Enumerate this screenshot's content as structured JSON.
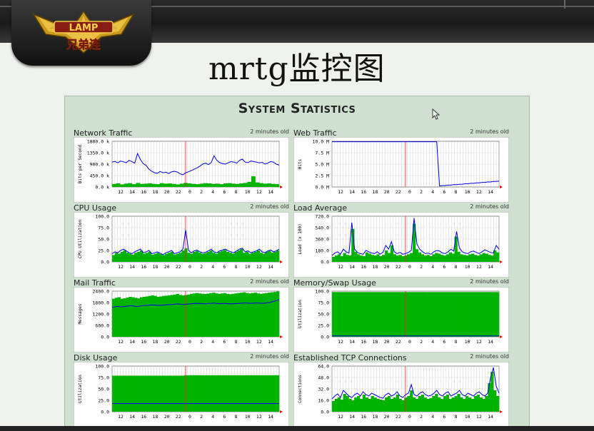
{
  "slide": {
    "title": "mrtg监控图"
  },
  "logo": {
    "text_latin": "LAMP",
    "text_cn": "兄弟连"
  },
  "stats": {
    "title": "System Statistics",
    "panels": [
      {
        "title": "Network Traffic",
        "age": "2 minutes old",
        "ylabel": "Bits per Second",
        "yticks": [
          "1800.0 k",
          "1350.0 k",
          "900.0 k",
          "450.0 k",
          "0.0 k"
        ],
        "ymax": 1800,
        "green": [
          120,
          140,
          100,
          130,
          150,
          110,
          160,
          120,
          130,
          140,
          120,
          110,
          150,
          130,
          140,
          120,
          100,
          130,
          160,
          140,
          120,
          110,
          130,
          150,
          140,
          120,
          130,
          110,
          140,
          150,
          130,
          120,
          140,
          160,
          200,
          420,
          180,
          150,
          130,
          140,
          120,
          110
        ],
        "blue": [
          980,
          1010,
          950,
          1020,
          990,
          960,
          1050,
          1000,
          940,
          1320,
          1080,
          920,
          850,
          700,
          620,
          560,
          540,
          610,
          560,
          580,
          530,
          600,
          620,
          590,
          520,
          480,
          560,
          600,
          650,
          700,
          750,
          820,
          900,
          940,
          880,
          960,
          1230,
          1050,
          960,
          920,
          900,
          950,
          1000,
          980,
          940,
          1050,
          1100,
          980,
          960,
          1020,
          1000,
          980,
          950,
          970,
          900,
          940,
          1000,
          980,
          900,
          860
        ]
      },
      {
        "title": "Web Traffic",
        "age": "2 minutes old",
        "ylabel": "Hits",
        "yticks": [
          "10.0 M",
          "7.5 M",
          "5.0 M",
          "2.5 M",
          "0.0 M"
        ],
        "ymax": 10,
        "green": [],
        "blue": [
          9.9,
          9.9,
          9.9,
          9.9,
          9.9,
          9.9,
          9.9,
          9.9,
          9.9,
          9.9,
          9.9,
          9.9,
          9.9,
          9.9,
          9.9,
          9.9,
          9.9,
          9.9,
          9.9,
          9.9,
          9.9,
          9.9,
          9.9,
          9.9,
          9.9,
          9.9,
          9.9,
          9.9,
          9.9,
          9.9,
          9.9,
          9.9,
          9.9,
          9.9,
          9.9,
          9.9,
          9.9,
          9.9,
          0.2,
          0.3,
          0.3,
          0.4,
          0.4,
          0.5,
          0.5,
          0.6,
          0.6,
          0.7,
          0.7,
          0.8,
          0.8,
          0.9,
          0.9,
          1.0,
          1.0,
          1.1,
          1.1,
          1.2,
          1.2,
          1.3
        ]
      },
      {
        "title": "CPU Usage",
        "age": "2 minutes old",
        "ylabel": "CPU Utilization",
        "yticks": [
          "100.0",
          "75.0",
          "50.0",
          "25.0",
          "0.0"
        ],
        "ymax": 100,
        "green": [
          15,
          20,
          18,
          22,
          25,
          20,
          18,
          16,
          20,
          22,
          25,
          18,
          20,
          22,
          16,
          18,
          20,
          17,
          15,
          18,
          20,
          22,
          16,
          18,
          20,
          25,
          30,
          20,
          18,
          22,
          24,
          20,
          18,
          19,
          22,
          25,
          20,
          18,
          22,
          24,
          26,
          22,
          20,
          18,
          22,
          25,
          28,
          20,
          22,
          18,
          20,
          22,
          25,
          20,
          18,
          22,
          24,
          20,
          22,
          25
        ],
        "blue": [
          18,
          22,
          20,
          25,
          28,
          24,
          20,
          18,
          22,
          25,
          28,
          20,
          22,
          25,
          18,
          20,
          22,
          19,
          16,
          20,
          22,
          25,
          18,
          20,
          22,
          28,
          70,
          25,
          20,
          24,
          26,
          22,
          20,
          21,
          24,
          28,
          22,
          20,
          24,
          26,
          28,
          24,
          22,
          20,
          24,
          28,
          30,
          22,
          24,
          20,
          22,
          24,
          28,
          22,
          20,
          24,
          26,
          22,
          24,
          28
        ]
      },
      {
        "title": "Load Average",
        "age": "2 minutes old",
        "ylabel": "Load (x 100)",
        "yticks": [
          "720.0",
          "540.0",
          "360.0",
          "180.0",
          "0.0"
        ],
        "ymax": 720,
        "green": [
          80,
          100,
          120,
          90,
          140,
          110,
          100,
          520,
          160,
          120,
          100,
          90,
          150,
          130,
          110,
          100,
          120,
          90,
          110,
          180,
          140,
          260,
          120,
          100,
          110,
          90,
          100,
          120,
          140,
          600,
          200,
          150,
          120,
          100,
          110,
          90,
          120,
          140,
          130,
          110,
          100,
          120,
          150,
          130,
          400,
          160,
          120,
          110,
          100,
          120,
          130,
          110,
          100,
          120,
          140,
          130,
          110,
          100,
          180,
          150
        ],
        "blue": [
          100,
          140,
          160,
          120,
          200,
          160,
          140,
          620,
          200,
          150,
          130,
          120,
          180,
          160,
          140,
          130,
          160,
          120,
          150,
          260,
          200,
          320,
          160,
          130,
          150,
          120,
          130,
          150,
          180,
          690,
          280,
          200,
          160,
          130,
          140,
          120,
          160,
          180,
          170,
          140,
          130,
          160,
          200,
          170,
          480,
          220,
          160,
          140,
          130,
          160,
          170,
          150,
          130,
          160,
          190,
          170,
          150,
          140,
          260,
          200
        ]
      },
      {
        "title": "Mail Traffic",
        "age": "2 minutes old",
        "ylabel": "Messages",
        "yticks": [
          "2400.0",
          "1800.0",
          "1200.0",
          "600.0",
          "0.0"
        ],
        "ymax": 2400,
        "green": [
          2000,
          2050,
          2080,
          2000,
          2020,
          2060,
          2100,
          2080,
          2050,
          2020,
          2080,
          2100,
          2120,
          2150,
          2180,
          2150,
          2100,
          2120,
          2150,
          2160,
          2180,
          2200,
          2220,
          2250,
          2200,
          2180,
          2200,
          2220,
          2260,
          2280,
          2300,
          2280,
          2260,
          2250,
          2270,
          2300,
          2320,
          2280,
          2260,
          2280,
          2300,
          2250,
          2240,
          2260,
          2280,
          2300,
          2320,
          2340,
          2300,
          2280,
          2300,
          2320,
          2280,
          2260,
          2280,
          2300,
          2320,
          2340,
          2360,
          2380
        ],
        "blue": [
          1550,
          1580,
          1600,
          1570,
          1590,
          1610,
          1620,
          1630,
          1600,
          1590,
          1620,
          1640,
          1650,
          1660,
          1680,
          1670,
          1650,
          1660,
          1670,
          1680,
          1690,
          1700,
          1710,
          1730,
          1720,
          1700,
          1710,
          1720,
          1740,
          1750,
          1760,
          1750,
          1740,
          1730,
          1750,
          1760,
          1770,
          1750,
          1740,
          1750,
          1760,
          1740,
          1730,
          1740,
          1750,
          1760,
          1770,
          1780,
          1770,
          1760,
          1770,
          1780,
          1770,
          1760,
          1770,
          1790,
          1820,
          1860,
          1900,
          1950
        ]
      },
      {
        "title": "Memory/Swap Usage",
        "age": "2 minutes old",
        "ylabel": "Utilization",
        "yticks": [
          "100.0",
          "75.0",
          "50.0",
          "25.0",
          "0.0"
        ],
        "ymax": 100,
        "green": [
          98,
          98,
          98,
          98,
          98,
          98,
          98,
          98,
          98,
          98,
          98,
          98,
          98,
          98,
          98,
          98,
          98,
          98,
          98,
          98,
          98,
          98,
          98,
          98,
          98,
          98,
          98,
          98,
          98,
          98,
          98,
          98,
          98,
          98,
          98,
          98,
          98,
          98,
          98,
          98,
          98,
          98,
          98,
          98,
          98,
          98,
          98,
          98,
          98,
          98,
          98,
          98,
          98,
          98,
          98,
          98,
          98,
          98,
          98,
          98
        ],
        "blue": [
          2,
          2,
          2,
          2,
          2,
          2,
          2,
          2,
          2,
          2,
          2,
          2,
          2,
          2,
          2,
          2,
          2,
          2,
          2,
          2,
          2,
          2,
          2,
          2,
          2,
          2,
          2,
          2,
          2,
          2,
          2,
          2,
          2,
          2,
          2,
          2,
          2,
          2,
          2,
          2,
          2,
          2,
          2,
          2,
          2,
          2,
          2,
          2,
          2,
          2,
          2,
          2,
          2,
          2,
          2,
          2,
          2,
          2,
          2,
          2
        ]
      },
      {
        "title": "Disk Usage",
        "age": "2 minutes old",
        "ylabel": "Utilization",
        "yticks": [
          "100.0",
          "75.0",
          "50.0",
          "25.0",
          "0.0"
        ],
        "ymax": 100,
        "green": [
          79,
          79,
          79,
          79,
          79,
          79,
          79,
          79,
          79,
          79,
          79,
          79,
          79,
          79,
          79,
          79,
          79,
          79,
          79,
          79,
          79,
          79,
          79,
          79,
          79,
          79,
          80,
          80,
          80,
          80,
          80,
          80,
          80,
          80,
          80,
          80,
          80,
          80,
          80,
          80,
          80,
          80,
          80,
          80,
          80,
          80,
          80,
          80,
          80,
          80,
          80,
          80,
          80,
          80,
          80,
          80,
          80,
          80,
          80,
          80
        ],
        "blue": [
          18,
          18,
          18,
          18,
          18,
          18,
          18,
          18,
          18,
          18,
          18,
          18,
          18,
          18,
          18,
          18,
          18,
          18,
          18,
          18,
          18,
          18,
          18,
          18,
          18,
          18,
          18,
          18,
          18,
          18,
          18,
          18,
          18,
          18,
          18,
          18,
          18,
          18,
          18,
          18,
          18,
          18,
          18,
          18,
          18,
          18,
          18,
          18,
          18,
          18,
          18,
          18,
          18,
          18,
          18,
          18,
          18,
          18,
          18,
          18
        ]
      },
      {
        "title": "Established TCP Connections",
        "age": "2 minutes old",
        "ylabel": "Connections",
        "yticks": [
          "64.0",
          "48.0",
          "32.0",
          "16.0",
          "0.0"
        ],
        "ymax": 64,
        "green": [
          15,
          18,
          20,
          17,
          25,
          22,
          18,
          16,
          20,
          22,
          18,
          24,
          20,
          18,
          22,
          20,
          18,
          17,
          16,
          20,
          22,
          18,
          20,
          24,
          18,
          16,
          20,
          22,
          30,
          20,
          18,
          22,
          24,
          20,
          18,
          19,
          22,
          25,
          20,
          18,
          22,
          24,
          18,
          20,
          22,
          25,
          20,
          18,
          22,
          20,
          18,
          22,
          24,
          20,
          18,
          22,
          40,
          56,
          30,
          22
        ],
        "blue": [
          18,
          22,
          25,
          20,
          30,
          26,
          22,
          20,
          24,
          26,
          22,
          28,
          24,
          22,
          26,
          24,
          22,
          20,
          19,
          24,
          26,
          22,
          24,
          28,
          22,
          20,
          24,
          26,
          38,
          24,
          22,
          26,
          28,
          24,
          22,
          23,
          26,
          30,
          24,
          22,
          26,
          28,
          22,
          24,
          26,
          30,
          24,
          22,
          26,
          24,
          22,
          26,
          28,
          24,
          22,
          26,
          48,
          62,
          36,
          26
        ]
      }
    ],
    "xticks": [
      "12",
      "14",
      "16",
      "18",
      "20",
      "22",
      "0",
      "2",
      "4",
      "6",
      "8",
      "10",
      "12",
      "14"
    ]
  }
}
